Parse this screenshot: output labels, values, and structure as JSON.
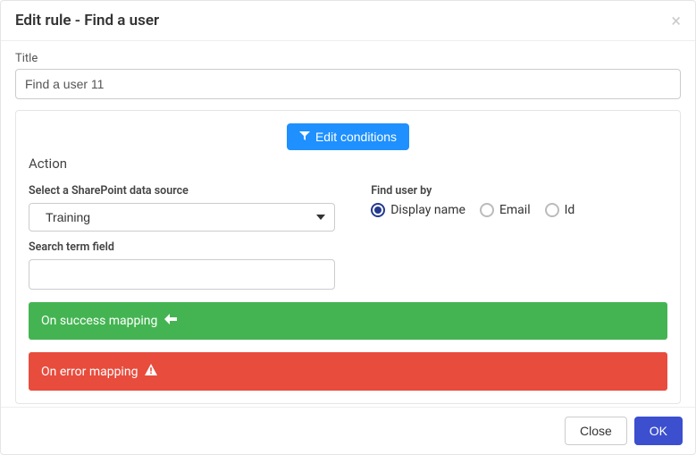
{
  "header": {
    "title": "Edit rule - Find a user"
  },
  "form": {
    "title_label": "Title",
    "title_value": "Find a user 11"
  },
  "card": {
    "edit_conditions": "Edit conditions",
    "section": "Action",
    "source_label": "Select a SharePoint data source",
    "source_selected": "Training",
    "find_by_label": "Find user by",
    "find_by_options": {
      "display_name": "Display name",
      "email": "Email",
      "id": "Id"
    },
    "find_by_selected": "display_name",
    "search_label": "Search term field",
    "search_value": ""
  },
  "bars": {
    "success": "On success mapping",
    "error": "On error mapping"
  },
  "footer": {
    "close": "Close",
    "ok": "OK"
  }
}
